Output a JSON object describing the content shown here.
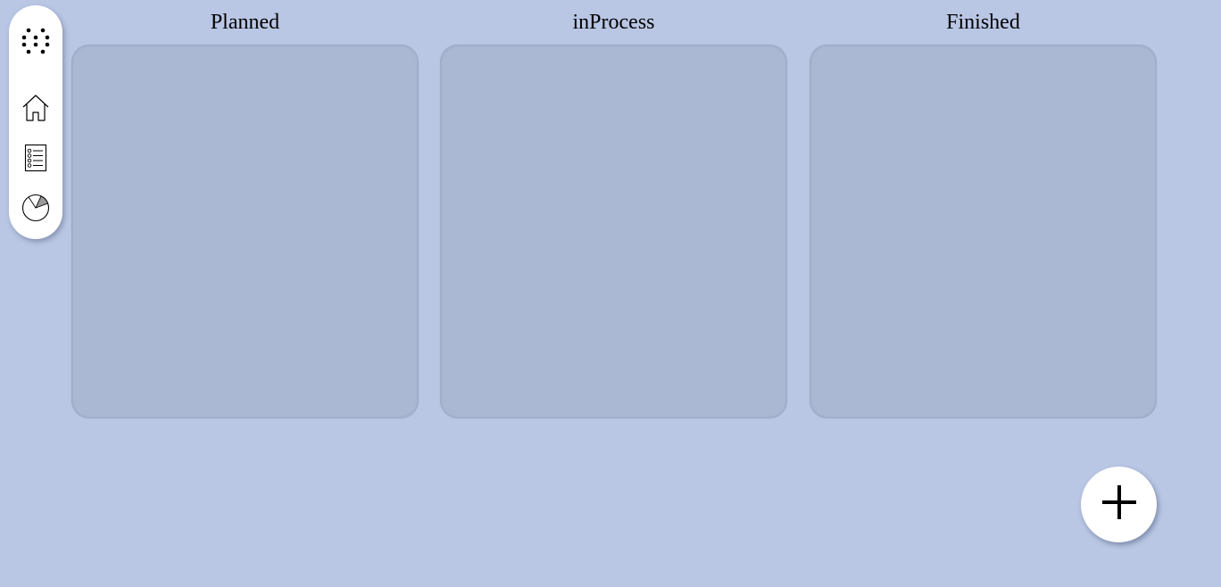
{
  "sidebar": {
    "items": [
      {
        "icon": "grid-dots-icon"
      },
      {
        "icon": "home-icon"
      },
      {
        "icon": "task-list-icon"
      },
      {
        "icon": "pie-chart-icon"
      }
    ]
  },
  "board": {
    "columns": [
      {
        "title": "Planned"
      },
      {
        "title": "inProcess"
      },
      {
        "title": "Finished"
      }
    ]
  },
  "fab": {
    "icon": "plus-icon"
  },
  "colors": {
    "background": "#b9c6e4",
    "column": "#abb8d4",
    "surface": "#ffffff"
  }
}
